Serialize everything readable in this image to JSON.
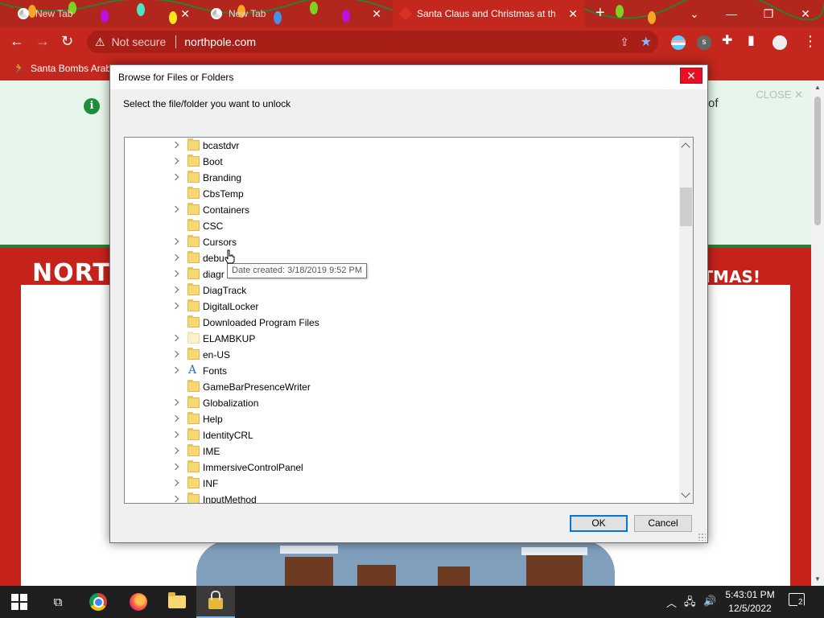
{
  "browser": {
    "tabs": [
      {
        "title": "New Tab",
        "active": false
      },
      {
        "title": "New Tab",
        "active": false
      },
      {
        "title": "Santa Claus and Christmas at the",
        "active": true
      }
    ],
    "address": {
      "security_label": "Not secure",
      "url": "northpole.com"
    },
    "bookmarks": [
      {
        "label": "Santa Bombs Arab"
      }
    ],
    "accent_color": "#c3271d"
  },
  "page": {
    "banner_close": "CLOSE",
    "banner_tail": "of",
    "title_left": "NORT",
    "title_right": "STMAS!"
  },
  "dialog": {
    "title": "Browse for Files or Folders",
    "prompt": "Select the file/folder you want to unlock",
    "tooltip": "Date created: 3/18/2019 9:52 PM",
    "ok_label": "OK",
    "cancel_label": "Cancel",
    "items": [
      {
        "label": "bcastdvr",
        "expandable": true,
        "icon": "folder-icon"
      },
      {
        "label": "Boot",
        "expandable": true,
        "icon": "folder-icon"
      },
      {
        "label": "Branding",
        "expandable": true,
        "icon": "folder-icon"
      },
      {
        "label": "CbsTemp",
        "expandable": false,
        "icon": "folder-icon"
      },
      {
        "label": "Containers",
        "expandable": true,
        "icon": "folder-icon"
      },
      {
        "label": "CSC",
        "expandable": false,
        "icon": "folder-icon"
      },
      {
        "label": "Cursors",
        "expandable": true,
        "icon": "folder-icon"
      },
      {
        "label": "debu",
        "expandable": true,
        "icon": "folder-icon"
      },
      {
        "label": "diagr",
        "expandable": true,
        "icon": "folder-icon"
      },
      {
        "label": "DiagTrack",
        "expandable": true,
        "icon": "folder-icon"
      },
      {
        "label": "DigitalLocker",
        "expandable": true,
        "icon": "folder-icon"
      },
      {
        "label": "Downloaded Program Files",
        "expandable": false,
        "icon": "folder-icon"
      },
      {
        "label": "ELAMBKUP",
        "expandable": true,
        "icon": "folder-faded-icon"
      },
      {
        "label": "en-US",
        "expandable": true,
        "icon": "folder-icon"
      },
      {
        "label": "Fonts",
        "expandable": true,
        "icon": "fonts-folder-icon"
      },
      {
        "label": "GameBarPresenceWriter",
        "expandable": false,
        "icon": "folder-icon"
      },
      {
        "label": "Globalization",
        "expandable": true,
        "icon": "folder-icon"
      },
      {
        "label": "Help",
        "expandable": true,
        "icon": "folder-icon"
      },
      {
        "label": "IdentityCRL",
        "expandable": true,
        "icon": "folder-icon"
      },
      {
        "label": "IME",
        "expandable": true,
        "icon": "folder-icon"
      },
      {
        "label": "ImmersiveControlPanel",
        "expandable": true,
        "icon": "folder-icon"
      },
      {
        "label": "INF",
        "expandable": true,
        "icon": "folder-icon"
      },
      {
        "label": "InputMethod",
        "expandable": true,
        "icon": "folder-icon"
      }
    ]
  },
  "taskbar": {
    "time": "5:43:01 PM",
    "date": "12/5/2022",
    "notification_count": "2",
    "apps": [
      "windows-start-icon",
      "task-view-icon",
      "chrome-icon",
      "firefox-icon",
      "file-explorer-icon",
      "unlocker-icon"
    ]
  }
}
